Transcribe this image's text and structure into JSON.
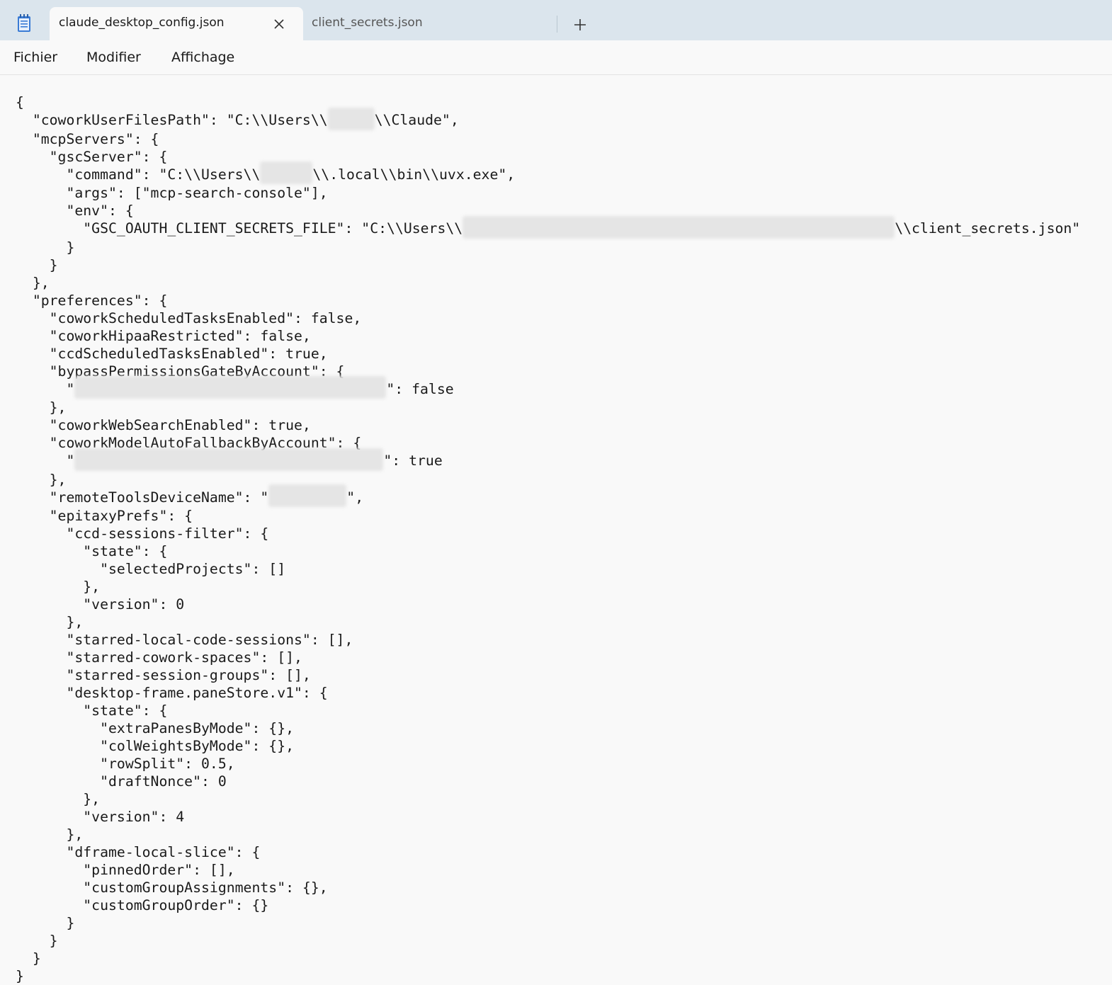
{
  "window": {
    "app_icon": "notepad-icon",
    "tabs": [
      {
        "label": "claude_desktop_config.json",
        "active": true
      },
      {
        "label": "client_secrets.json",
        "active": false
      }
    ],
    "close_icon": "close-icon",
    "new_tab_icon": "plus-icon"
  },
  "menu": {
    "items": [
      "Fichier",
      "Modifier",
      "Affichage"
    ]
  },
  "editor": {
    "lines": [
      {
        "t": "{"
      },
      {
        "t": "  \"coworkUserFilesPath\": \"C:\\\\Users\\\\",
        "r": true,
        "a": "\\\\Claude\","
      },
      {
        "t": "  \"mcpServers\": {"
      },
      {
        "t": "    \"gscServer\": {"
      },
      {
        "t": "      \"command\": \"C:\\\\Users\\\\",
        "r": true,
        "a": "\\\\.local\\\\bin\\\\uvx.exe\","
      },
      {
        "t": "      \"args\": [\"mcp-search-console\"],"
      },
      {
        "t": "      \"env\": {"
      },
      {
        "t": "        \"GSC_OAUTH_CLIENT_SECRETS_FILE\": \"C:\\\\Users\\\\",
        "r": true,
        "a": "\\\\client_secrets.json\""
      },
      {
        "t": "      }"
      },
      {
        "t": "    }"
      },
      {
        "t": "  },"
      },
      {
        "t": "  \"preferences\": {"
      },
      {
        "t": "    \"coworkScheduledTasksEnabled\": false,"
      },
      {
        "t": "    \"coworkHipaaRestricted\": false,"
      },
      {
        "t": "    \"ccdScheduledTasksEnabled\": true,"
      },
      {
        "t": "    \"bypassPermissionsGateByAccount\": {"
      },
      {
        "t": "      \"",
        "r": true,
        "a": "\": false"
      },
      {
        "t": "    },"
      },
      {
        "t": "    \"coworkWebSearchEnabled\": true,"
      },
      {
        "t": "    \"coworkModelAutoFallbackByAccount\": {"
      },
      {
        "t": "      \"",
        "r": true,
        "a": "\": true"
      },
      {
        "t": "    },"
      },
      {
        "t": "    \"remoteToolsDeviceName\": \"",
        "r": true,
        "a": "\","
      },
      {
        "t": "    \"epitaxyPrefs\": {"
      },
      {
        "t": "      \"ccd-sessions-filter\": {"
      },
      {
        "t": "        \"state\": {"
      },
      {
        "t": "          \"selectedProjects\": []"
      },
      {
        "t": "        },"
      },
      {
        "t": "        \"version\": 0"
      },
      {
        "t": "      },"
      },
      {
        "t": "      \"starred-local-code-sessions\": [],"
      },
      {
        "t": "      \"starred-cowork-spaces\": [],"
      },
      {
        "t": "      \"starred-session-groups\": [],"
      },
      {
        "t": "      \"desktop-frame.paneStore.v1\": {"
      },
      {
        "t": "        \"state\": {"
      },
      {
        "t": "          \"extraPanesByMode\": {},"
      },
      {
        "t": "          \"colWeightsByMode\": {},"
      },
      {
        "t": "          \"rowSplit\": 0.5,"
      },
      {
        "t": "          \"draftNonce\": 0"
      },
      {
        "t": "        },"
      },
      {
        "t": "        \"version\": 4"
      },
      {
        "t": "      },"
      },
      {
        "t": "      \"dframe-local-slice\": {"
      },
      {
        "t": "        \"pinnedOrder\": [],"
      },
      {
        "t": "        \"customGroupAssignments\": {},"
      },
      {
        "t": "        \"customGroupOrder\": {}"
      },
      {
        "t": "      }"
      },
      {
        "t": "    }"
      },
      {
        "t": "  }"
      },
      {
        "t": "}"
      }
    ]
  }
}
